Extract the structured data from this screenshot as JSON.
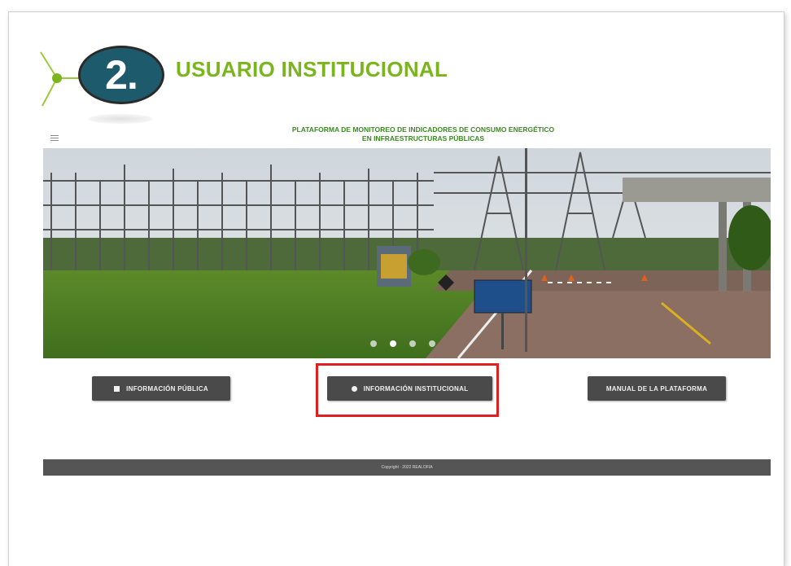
{
  "header": {
    "step_number": "2.",
    "title": "USUARIO INSTITUCIONAL"
  },
  "platform": {
    "title_line1": "PLATAFORMA DE MONITOREO DE INDICADORES DE CONSUMO ENERGÉTICO",
    "title_line2": "EN INFRAESTRUCTURAS PÚBLICAS"
  },
  "carousel": {
    "slide_count": 4,
    "active_index": 1
  },
  "buttons": {
    "public_label": "INFORMACIÓN PÚBLICA",
    "institutional_label": "INFORMACIÓN INSTITUCIONAL",
    "manual_label": "MANUAL DE LA PLATAFORMA"
  },
  "footer": {
    "copyright": "Copyright · 2022 REALOFIA"
  },
  "colors": {
    "accent_green": "#7ab51d",
    "badge_teal": "#1d5a6b",
    "highlight_red": "#e02020",
    "button_gray": "#4a4a4a",
    "footer_gray": "#555555"
  },
  "icons": {
    "public": "document-icon",
    "institutional": "circle-icon",
    "menu": "hamburger-icon"
  }
}
